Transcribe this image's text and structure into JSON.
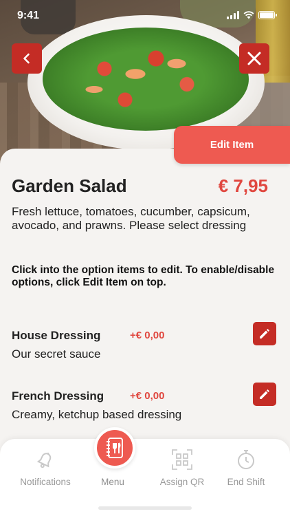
{
  "status_bar": {
    "time": "9:41"
  },
  "header": {
    "back_icon": "chevron-left-icon",
    "close_icon": "close-icon",
    "edit_label": "Edit Item",
    "accent_color": "#c42c25",
    "edit_color": "#ee5a51"
  },
  "item": {
    "name": "Garden Salad",
    "price": "€ 7,95",
    "description": "Fresh lettuce, tomatoes, cucumber, capsicum, avocado, and prawns. Please select dressing",
    "hint": "Click into the option items to edit. To enable/disable options, click Edit Item on top."
  },
  "options": [
    {
      "name": "House Dressing",
      "price": "+€ 0,00",
      "description": "Our secret sauce",
      "icon": "pencil-icon"
    },
    {
      "name": "French Dressing",
      "price": "+€ 0,00",
      "description": "Creamy, ketchup based dressing",
      "icon": "pencil-icon"
    }
  ],
  "nav": {
    "items": [
      {
        "label": "Notifications",
        "icon": "bell-icon"
      },
      {
        "label": "Menu",
        "icon": "menu-book-icon",
        "active": true
      },
      {
        "label": "Assign QR",
        "icon": "qr-scan-icon"
      },
      {
        "label": "End Shift",
        "icon": "stopwatch-icon"
      }
    ]
  }
}
